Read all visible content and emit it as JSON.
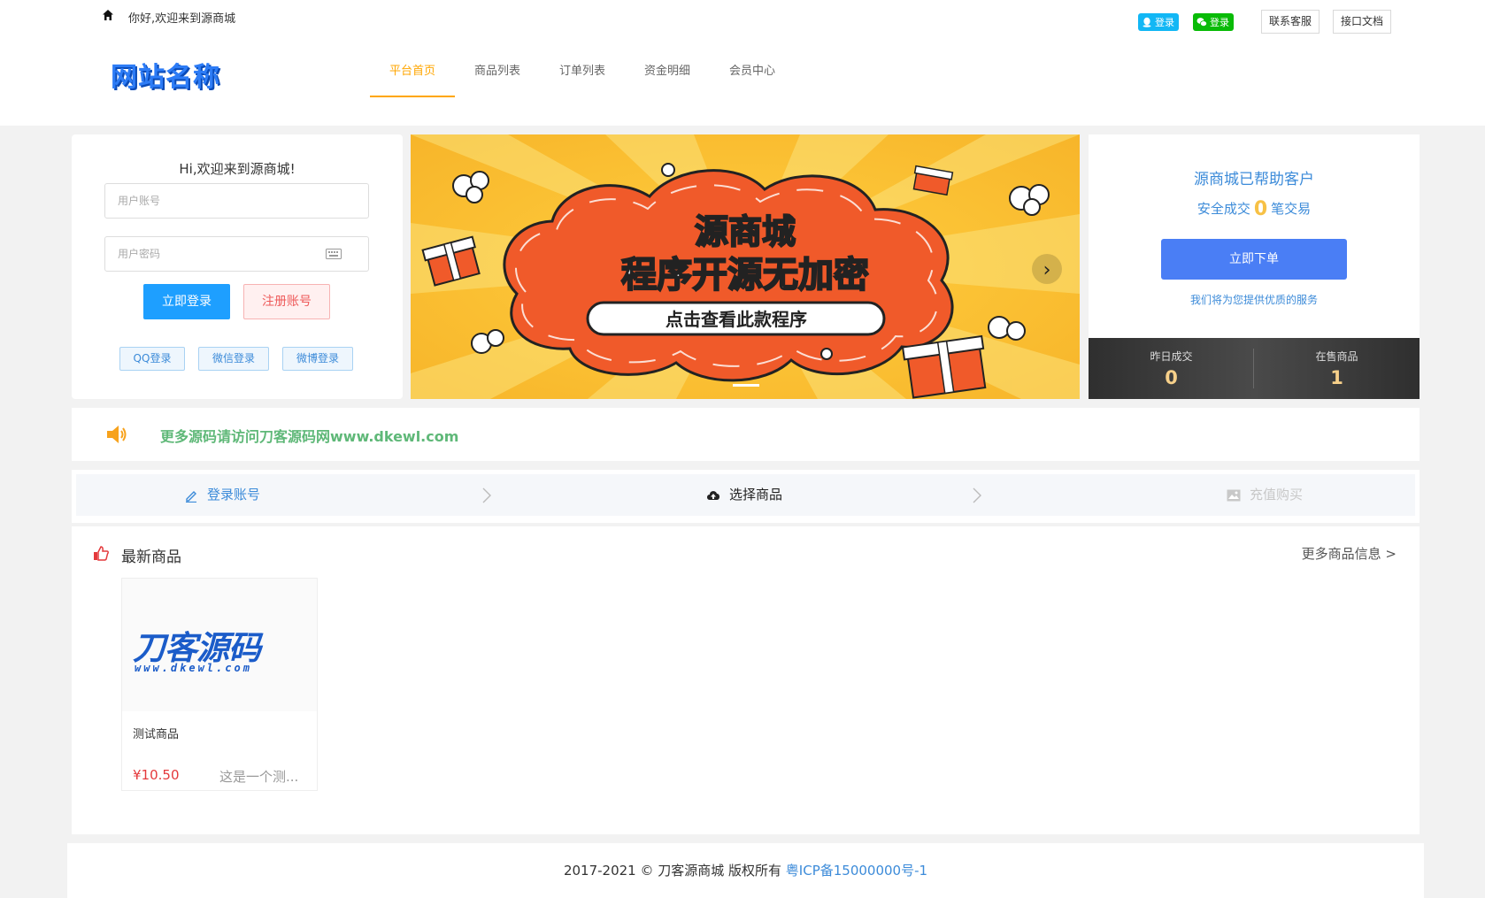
{
  "header": {
    "welcome": "你好,欢迎来到源商城",
    "qq_login": "登录",
    "wechat_login": "登录",
    "contact_service": "联系客服",
    "api_docs": "接口文档",
    "logo_text": "网站名称",
    "nav": [
      {
        "label": "平台首页",
        "active": true
      },
      {
        "label": "商品列表",
        "active": false
      },
      {
        "label": "订单列表",
        "active": false
      },
      {
        "label": "资金明细",
        "active": false
      },
      {
        "label": "会员中心",
        "active": false
      }
    ]
  },
  "login": {
    "title": "Hi,欢迎来到源商城!",
    "username_placeholder": "用户账号",
    "password_placeholder": "用户密码",
    "login_button": "立即登录",
    "register_button": "注册账号",
    "qq_button": "QQ登录",
    "wechat_button": "微信登录",
    "weibo_button": "微博登录"
  },
  "banner": {
    "line1": "源商城",
    "line2": "程序开源无加密",
    "line3": "点击查看此款程序"
  },
  "stats": {
    "title": "源商城已帮助客户",
    "safe_prefix": "安全成交",
    "safe_count": "0",
    "safe_suffix": "笔交易",
    "order_button": "立即下单",
    "service_note": "我们将为您提供优质的服务",
    "yesterday_label": "昨日成交",
    "yesterday_value": "0",
    "on_sale_label": "在售商品",
    "on_sale_value": "1"
  },
  "notice": {
    "text": "更多源码请访问刀客源码网www.dkewl.com"
  },
  "steps": [
    {
      "label": "登录账号",
      "state": "done"
    },
    {
      "label": "选择商品",
      "state": "current"
    },
    {
      "label": "充值购买",
      "state": "pending"
    }
  ],
  "products": {
    "heading": "最新商品",
    "more": "更多商品信息 >",
    "items": [
      {
        "logo_text": "刀客源码",
        "logo_url": "www.dkewl.com",
        "name": "测试商品",
        "price": "¥10.50",
        "desc": "这是一个测..."
      }
    ]
  },
  "footer": {
    "copyright": "2017-2021 © 刀客源商城 版权所有",
    "icp": "粤ICP备15000000号-1"
  },
  "colors": {
    "accent_orange": "#ffa600",
    "primary_blue": "#1e9fff",
    "order_blue": "#4a7ef5",
    "notice_green": "#5fb878",
    "price_red": "#e4393c"
  }
}
